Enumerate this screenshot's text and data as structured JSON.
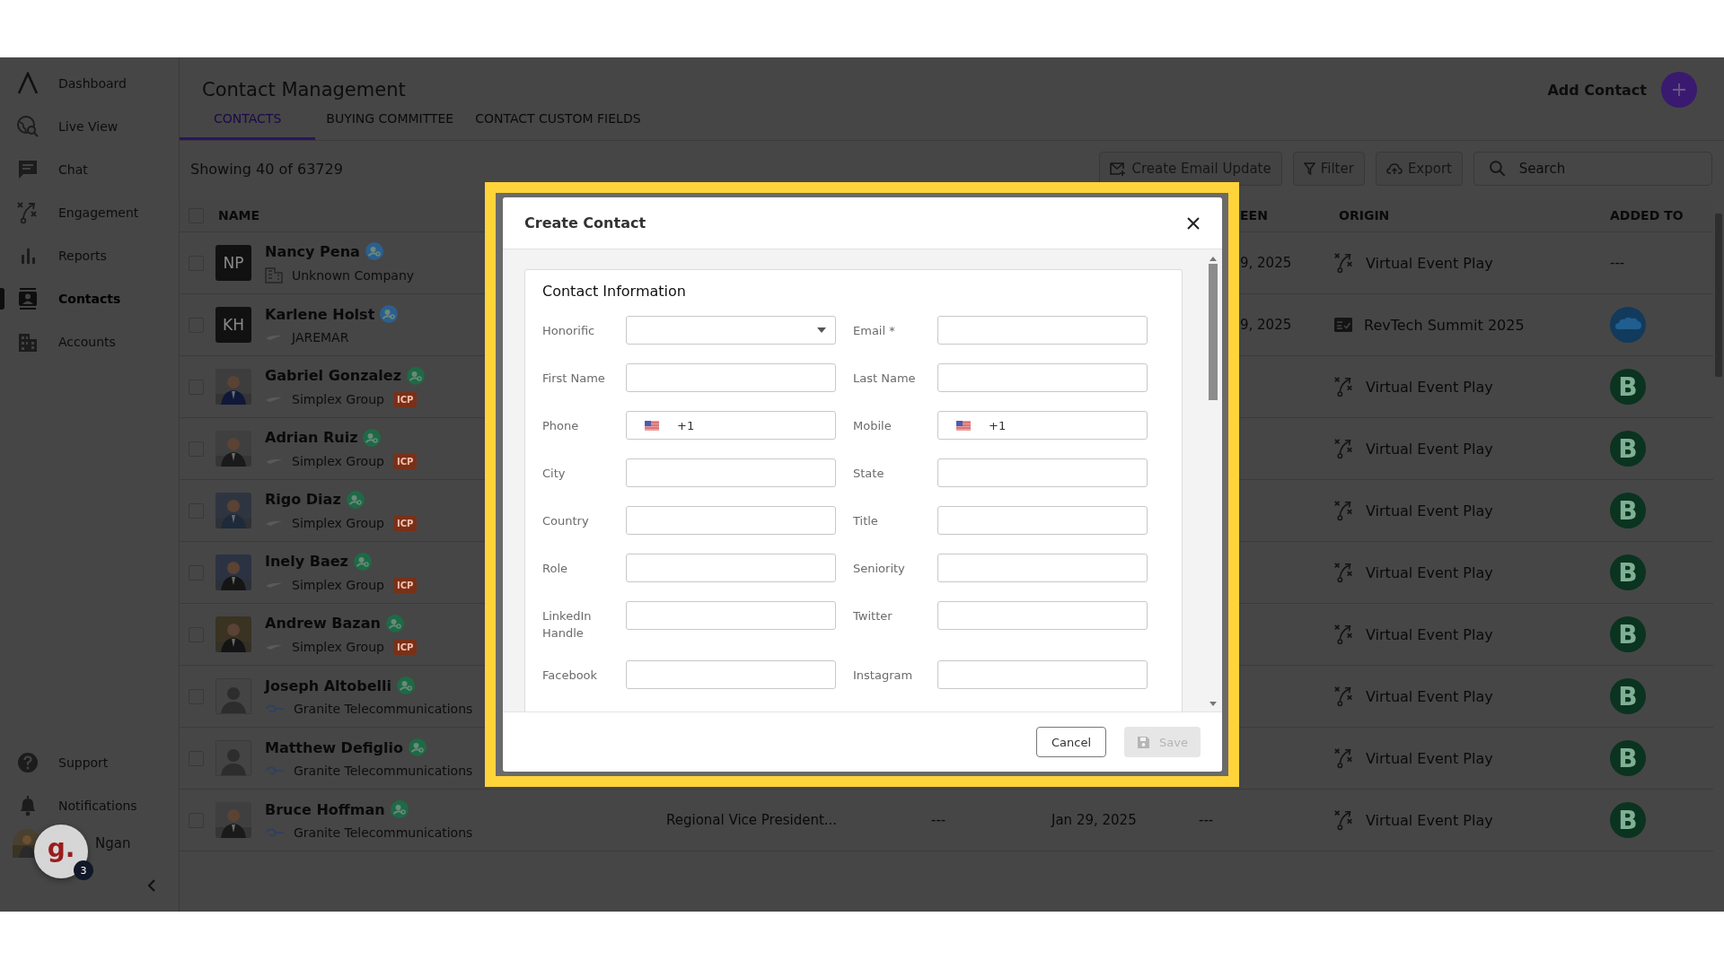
{
  "sidebar": {
    "nav": [
      {
        "label": "Dashboard",
        "selected": false
      },
      {
        "label": "Live View",
        "selected": false
      },
      {
        "label": "Chat",
        "selected": false
      },
      {
        "label": "Engagement",
        "selected": false
      },
      {
        "label": "Reports",
        "selected": false
      },
      {
        "label": "Contacts",
        "selected": true
      },
      {
        "label": "Accounts",
        "selected": false
      }
    ],
    "footer_items": [
      {
        "label": "Support"
      },
      {
        "label": "Notifications"
      }
    ],
    "user": {
      "name": "Ngan"
    },
    "widget": {
      "letter": "g.",
      "badge": "3"
    }
  },
  "header": {
    "title": "Contact Management",
    "add_label": "Add Contact",
    "tabs": [
      {
        "label": "CONTACTS",
        "selected": true
      },
      {
        "label": "BUYING COMMITTEE",
        "selected": false
      },
      {
        "label": "CONTACT CUSTOM FIELDS",
        "selected": false
      }
    ]
  },
  "toolbar": {
    "showing": "Showing 40 of  63729",
    "buttons": [
      "Create Email Update",
      "Filter",
      "Export"
    ],
    "search_placeholder": "Search"
  },
  "table": {
    "all_selected": false,
    "columns": [
      "NAME",
      "EEN",
      "ORIGIN",
      "ADDED TO"
    ],
    "rows": [
      {
        "selected": false,
        "name": "Nancy Pena",
        "color": "#2c5f8f",
        "avatar": {
          "kind": "initials",
          "text": "NP"
        },
        "company_logo": {
          "kind": "building"
        },
        "company": "Unknown Company",
        "last_seen": "9, 2025",
        "origin": {
          "kind": "play",
          "text": "Virtual Event Play"
        },
        "added_to": {
          "kind": "none",
          "text": "---"
        }
      },
      {
        "selected": false,
        "name": "Karlene Holst",
        "color": "#2c5f8f",
        "avatar": {
          "kind": "initials",
          "text": "KH"
        },
        "company_logo": {
          "kind": "wing"
        },
        "company": "JAREMAR",
        "last_seen": "9, 2025",
        "origin": {
          "kind": "event",
          "text": "RevTech Summit 2025"
        },
        "added_to": {
          "kind": "cloud"
        }
      },
      {
        "selected": false,
        "name": "Gabriel Gonzalez",
        "color": "#1e6a46",
        "company_logo": {
          "kind": "wing"
        },
        "company": "Simplex Group",
        "tag": "ICP",
        "origin": {
          "kind": "play",
          "text": "Virtual Event Play"
        },
        "added_to": {
          "kind": "letter",
          "text": "B"
        }
      },
      {
        "selected": false,
        "name": "Adrian Ruiz",
        "color": "#1e6a46",
        "company_logo": {
          "kind": "wing"
        },
        "company": "Simplex Group",
        "tag": "ICP",
        "origin": {
          "kind": "play",
          "text": "Virtual Event Play"
        },
        "added_to": {
          "kind": "letter",
          "text": "B"
        }
      },
      {
        "selected": false,
        "name": "Rigo Diaz",
        "color": "#1e6a46",
        "company_logo": {
          "kind": "wing"
        },
        "company": "Simplex Group",
        "tag": "ICP",
        "origin": {
          "kind": "play",
          "text": "Virtual Event Play"
        },
        "added_to": {
          "kind": "letter",
          "text": "B"
        }
      },
      {
        "selected": false,
        "name": "Inely Baez",
        "color": "#1e6a46",
        "company_logo": {
          "kind": "wing"
        },
        "company": "Simplex Group",
        "tag": "ICP",
        "origin": {
          "kind": "play",
          "text": "Virtual Event Play"
        },
        "added_to": {
          "kind": "letter",
          "text": "B"
        }
      },
      {
        "selected": false,
        "name": "Andrew Bazan",
        "color": "#1e6a46",
        "company_logo": {
          "kind": "wing"
        },
        "company": "Simplex Group",
        "tag": "ICP",
        "origin": {
          "kind": "play",
          "text": "Virtual Event Play"
        },
        "added_to": {
          "kind": "letter",
          "text": "B"
        }
      },
      {
        "selected": false,
        "name": "Joseph Altobelli",
        "color": "#1e6a46",
        "avatar": {
          "kind": "default"
        },
        "company_logo": {
          "kind": "swirl"
        },
        "company": "Granite Telecommunications",
        "origin": {
          "kind": "play",
          "text": "Virtual Event Play"
        },
        "added_to": {
          "kind": "letter",
          "text": "B"
        }
      },
      {
        "selected": false,
        "name": "Matthew Defiglio",
        "color": "#1e6a46",
        "avatar": {
          "kind": "default"
        },
        "company_logo": {
          "kind": "swirl"
        },
        "company": "Granite Telecommunications",
        "origin": {
          "kind": "play",
          "text": "Virtual Event Play"
        },
        "added_to": {
          "kind": "letter",
          "text": "B"
        }
      },
      {
        "selected": false,
        "name": "Bruce Hoffman",
        "color": "#1e6a46",
        "company_logo": {
          "kind": "swirl"
        },
        "company": "Granite Telecommunications",
        "job_title": "Regional Vice President...",
        "column_5": "---",
        "created": "Jan 29, 2025",
        "last_seen": "---",
        "origin": {
          "kind": "play",
          "text": "Virtual Event Play"
        },
        "added_to": {
          "kind": "letter",
          "text": "B"
        }
      }
    ]
  },
  "dialog": {
    "title": "Create Contact",
    "section": "Contact Information",
    "fields": [
      {
        "label": "Honorific",
        "kind": "select"
      },
      {
        "label": "Email *",
        "kind": "text"
      },
      {
        "label": "First Name",
        "kind": "text"
      },
      {
        "label": "Last Name",
        "kind": "text"
      },
      {
        "label": "Phone",
        "kind": "phone",
        "value": "+1"
      },
      {
        "label": "Mobile",
        "kind": "phone",
        "value": "+1"
      },
      {
        "label": "City",
        "kind": "text"
      },
      {
        "label": "State",
        "kind": "text"
      },
      {
        "label": "Country",
        "kind": "text"
      },
      {
        "label": "Title",
        "kind": "text"
      },
      {
        "label": "Role",
        "kind": "text"
      },
      {
        "label": "Seniority",
        "kind": "text"
      },
      {
        "label": "LinkedIn Handle",
        "kind": "text"
      },
      {
        "label": "Twitter",
        "kind": "text"
      },
      {
        "label": "Facebook",
        "kind": "text"
      },
      {
        "label": "Instagram",
        "kind": "text"
      }
    ],
    "cancel": "Cancel",
    "save": {
      "label": "Save",
      "disabled": true
    }
  }
}
